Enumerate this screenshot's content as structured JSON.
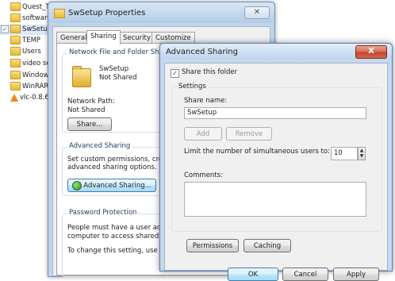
{
  "explorer": {
    "items": [
      {
        "label": "Quest_T",
        "checked": false
      },
      {
        "label": "software",
        "checked": false
      },
      {
        "label": "SwSetup",
        "checked": true
      },
      {
        "label": "TEMP",
        "checked": false
      },
      {
        "label": "Users",
        "checked": false
      },
      {
        "label": "video sc",
        "checked": false
      },
      {
        "label": "Window",
        "checked": false
      },
      {
        "label": "WinRAR",
        "checked": false
      },
      {
        "label": "vlc-0.8.6",
        "checked": false
      }
    ],
    "checkmark": "✓"
  },
  "properties": {
    "title": "SwSetup Properties",
    "close": "✕",
    "tabs": [
      "General",
      "Sharing",
      "Security",
      "Customize"
    ],
    "active_tab": "Sharing",
    "network_sharing": {
      "heading": "Network File and Folder Sharing",
      "folder_name": "SwSetup",
      "status": "Not Shared",
      "path_label": "Network Path:",
      "path_value": "Not Shared",
      "share_button": "Share..."
    },
    "advanced_sharing": {
      "heading": "Advanced Sharing",
      "desc_line1": "Set custom permissions, create",
      "desc_line2": "advanced sharing options.",
      "button": "Advanced Sharing..."
    },
    "password": {
      "heading": "Password Protection",
      "line1": "People must have a user accou",
      "line2": "computer to access shared fold",
      "line3": "To change this setting, use the"
    }
  },
  "advanced_dialog": {
    "title": "Advanced Sharing",
    "close": "X",
    "share_checkbox_label": "Share this folder",
    "share_checked": true,
    "checkmark": "✓",
    "settings_label": "Settings",
    "share_name_label": "Share name:",
    "share_name_value": "SwSetup",
    "add_button": "Add",
    "remove_button": "Remove",
    "limit_label": "Limit the number of simultaneous users to:",
    "limit_value": "10",
    "spin_up": "▲",
    "spin_down": "▼",
    "comments_label": "Comments:",
    "comments_value": "",
    "permissions_button": "Permissions",
    "caching_button": "Caching",
    "ok_button": "OK",
    "cancel_button": "Cancel",
    "apply_button": "Apply"
  }
}
